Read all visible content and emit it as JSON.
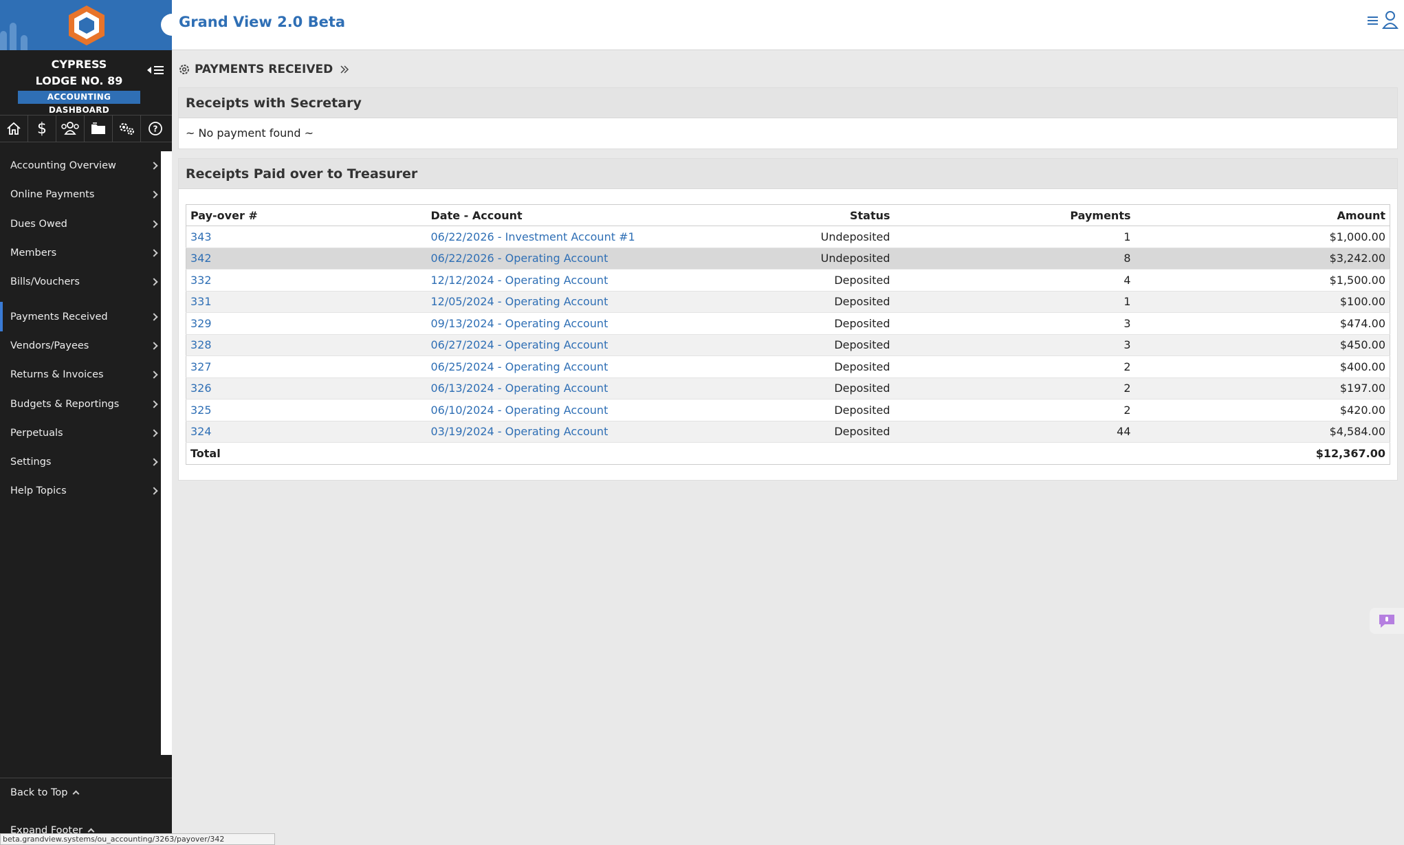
{
  "app": {
    "title": "Grand View 2.0 Beta"
  },
  "brand": {
    "accent": "#2f6fb5",
    "logo_orange": "#e8742a"
  },
  "sidebar": {
    "lodge_line1": "CYPRESS",
    "lodge_line2": "LODGE NO. 89",
    "dashboard_badge": "ACCOUNTING DASHBOARD",
    "icons": [
      "home-icon",
      "dollar-icon",
      "members-icon",
      "folder-icon",
      "gears-icon",
      "help-icon"
    ],
    "items": [
      {
        "label": "Accounting Overview"
      },
      {
        "label": "Online Payments"
      },
      {
        "label": "Dues Owed"
      },
      {
        "label": "Members"
      },
      {
        "label": "Bills/Vouchers"
      },
      {
        "label": "Payments Received"
      },
      {
        "label": "Vendors/Payees"
      },
      {
        "label": "Returns & Invoices"
      },
      {
        "label": "Budgets & Reportings"
      },
      {
        "label": "Perpetuals"
      },
      {
        "label": "Settings"
      },
      {
        "label": "Help Topics"
      }
    ],
    "back_to_top": "Back to Top",
    "expand_footer": "Expand Footer"
  },
  "page": {
    "heading": "PAYMENTS RECEIVED"
  },
  "secretary_panel": {
    "title": "Receipts with Secretary",
    "empty_message": "~ No payment found ~"
  },
  "treasurer_panel": {
    "title": "Receipts Paid over to Treasurer",
    "columns": {
      "payover": "Pay-over #",
      "date_account": "Date - Account",
      "status": "Status",
      "payments": "Payments",
      "amount": "Amount"
    },
    "rows": [
      {
        "payover": "343",
        "date_account": "06/22/2026 - Investment Account #1",
        "status": "Undeposited",
        "payments": "1",
        "amount": "$1,000.00"
      },
      {
        "payover": "342",
        "date_account": "06/22/2026 - Operating Account",
        "status": "Undeposited",
        "payments": "8",
        "amount": "$3,242.00"
      },
      {
        "payover": "332",
        "date_account": "12/12/2024 - Operating Account",
        "status": "Deposited",
        "payments": "4",
        "amount": "$1,500.00"
      },
      {
        "payover": "331",
        "date_account": "12/05/2024 - Operating Account",
        "status": "Deposited",
        "payments": "1",
        "amount": "$100.00"
      },
      {
        "payover": "329",
        "date_account": "09/13/2024 - Operating Account",
        "status": "Deposited",
        "payments": "3",
        "amount": "$474.00"
      },
      {
        "payover": "328",
        "date_account": "06/27/2024 - Operating Account",
        "status": "Deposited",
        "payments": "3",
        "amount": "$450.00"
      },
      {
        "payover": "327",
        "date_account": "06/25/2024 - Operating Account",
        "status": "Deposited",
        "payments": "2",
        "amount": "$400.00"
      },
      {
        "payover": "326",
        "date_account": "06/13/2024 - Operating Account",
        "status": "Deposited",
        "payments": "2",
        "amount": "$197.00"
      },
      {
        "payover": "325",
        "date_account": "06/10/2024 - Operating Account",
        "status": "Deposited",
        "payments": "2",
        "amount": "$420.00"
      },
      {
        "payover": "324",
        "date_account": "03/19/2024 - Operating Account",
        "status": "Deposited",
        "payments": "44",
        "amount": "$4,584.00"
      }
    ],
    "total_label": "Total",
    "total_amount": "$12,367.00"
  },
  "status_url": "beta.grandview.systems/ou_accounting/3263/payover/342"
}
